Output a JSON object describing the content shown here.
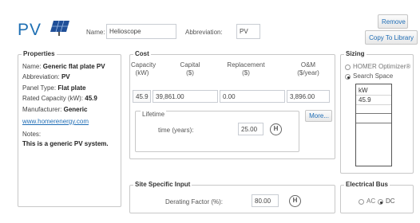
{
  "header": {
    "title": "PV",
    "name_label": "Name:",
    "name_value": "Helioscope",
    "abbrev_label": "Abbreviation:",
    "abbrev_value": "PV",
    "remove_button": "Remove",
    "copy_button": "Copy To Library"
  },
  "properties": {
    "title": "Properties",
    "name_label": "Name:",
    "name_value": "Generic flat plate PV",
    "abbrev_label": "Abbreviation:",
    "abbrev_value": "PV",
    "panel_label": "Panel Type:",
    "panel_value": "Flat plate",
    "capacity_label": "Rated Capacity (kW):",
    "capacity_value": "45.9",
    "manufacturer_label": "Manufacturer:",
    "manufacturer_value": "Generic",
    "website": "www.homerenergy.com",
    "notes_label": "Notes:",
    "notes_value": "This is a generic PV system."
  },
  "cost": {
    "title": "Cost",
    "headers": {
      "capacity": [
        "Capacity",
        "(kW)"
      ],
      "capital": [
        "Capital",
        "($)"
      ],
      "replacement": [
        "Replacement",
        "($)"
      ],
      "om": [
        "O&M",
        "($/year)"
      ]
    },
    "row": {
      "capacity": "45.9",
      "capital": "39,861.00",
      "replacement": "0.00",
      "om": "3,896.00"
    },
    "more_button": "More...",
    "lifetime_label": "Lifetime",
    "time_label": "time (years):",
    "time_value": "25.00"
  },
  "sizing": {
    "title": "Sizing",
    "option1": "HOMER Optimizer®",
    "option2": "Search Space",
    "selected": "Search Space",
    "list_header": "kW",
    "list_values": [
      "45.9"
    ]
  },
  "site": {
    "title": "Site Specific Input",
    "derating_label": "Derating Factor (%):",
    "derating_value": "80.00"
  },
  "bus": {
    "title": "Electrical Bus",
    "option_ac": "AC",
    "option_dc": "DC",
    "selected": "DC"
  },
  "icons": {
    "hold": "H"
  }
}
